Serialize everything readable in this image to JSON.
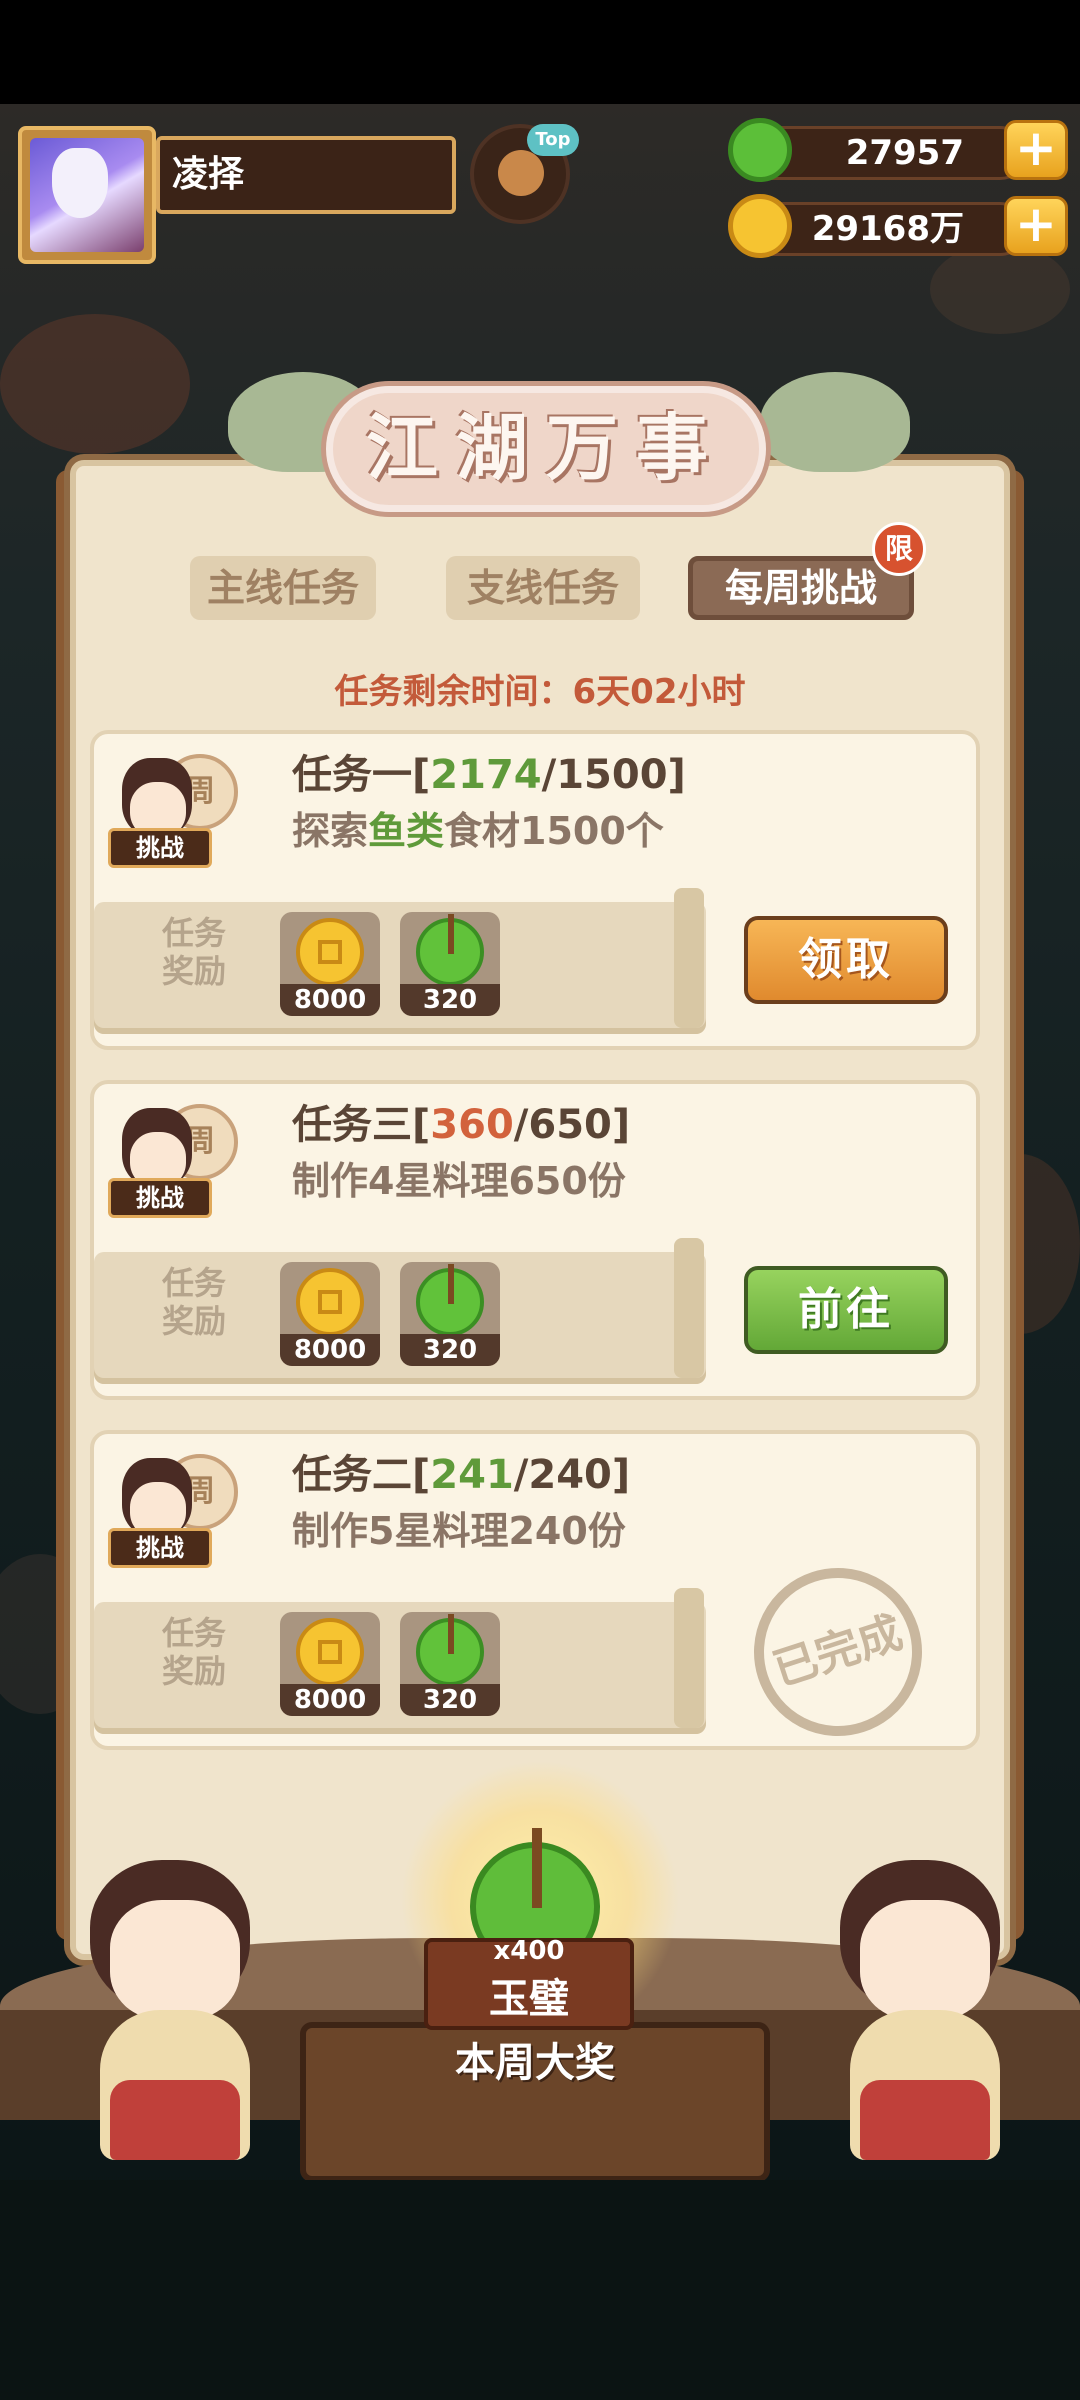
{
  "player": {
    "name": "凌择"
  },
  "top_icon": {
    "tag": "Top"
  },
  "currencies": {
    "jade": {
      "value": "27957",
      "icon": "jade-coin-icon"
    },
    "gold": {
      "value": "29168万",
      "icon": "gold-coin-icon"
    },
    "plus_label": "+"
  },
  "panel": {
    "title": "江湖万事",
    "tabs": [
      {
        "label": "主线任务",
        "active": false
      },
      {
        "label": "支线任务",
        "active": false
      },
      {
        "label": "每周挑战",
        "active": true,
        "badge": "限"
      }
    ],
    "timer": "任务剩余时间：6天02小时"
  },
  "tasks": [
    {
      "char_badge": "周",
      "char_label": "挑战",
      "title_prefix": "任务一[",
      "progress": "2174",
      "progress_color": "green",
      "sep": "/",
      "target": "1500",
      "title_suffix": "]",
      "desc_prefix": "探索",
      "desc_highlight": "鱼类",
      "desc_suffix": "食材1500个",
      "reward_label_1": "任务",
      "reward_label_2": "奖励",
      "rewards": [
        {
          "icon": "gold-coin-icon",
          "qty": "8000"
        },
        {
          "icon": "jade-coin-icon",
          "qty": "320"
        }
      ],
      "action": {
        "type": "claim",
        "label": "领取"
      }
    },
    {
      "char_badge": "周",
      "char_label": "挑战",
      "title_prefix": "任务三[",
      "progress": "360",
      "progress_color": "orange",
      "sep": "/",
      "target": "650",
      "title_suffix": "]",
      "desc_prefix": "制作4星料理650份",
      "desc_highlight": "",
      "desc_suffix": "",
      "reward_label_1": "任务",
      "reward_label_2": "奖励",
      "rewards": [
        {
          "icon": "gold-coin-icon",
          "qty": "8000"
        },
        {
          "icon": "jade-coin-icon",
          "qty": "320"
        }
      ],
      "action": {
        "type": "go",
        "label": "前往"
      }
    },
    {
      "char_badge": "周",
      "char_label": "挑战",
      "title_prefix": "任务二[",
      "progress": "241",
      "progress_color": "green",
      "sep": "/",
      "target": "240",
      "title_suffix": "]",
      "desc_prefix": "制作5星料理240份",
      "desc_highlight": "",
      "desc_suffix": "",
      "reward_label_1": "任务",
      "reward_label_2": "奖励",
      "rewards": [
        {
          "icon": "gold-coin-icon",
          "qty": "8000"
        },
        {
          "icon": "jade-coin-icon",
          "qty": "320"
        }
      ],
      "action": {
        "type": "done",
        "label": "已完成"
      }
    }
  ],
  "weekly_prize": {
    "qty": "x400",
    "name": "玉璧",
    "caption": "本周大奖"
  },
  "colors": {
    "accent_red": "#c35a3a",
    "progress_green": "#5f9a3a",
    "progress_orange": "#d2623c",
    "claim_button": "#e08a2e",
    "go_button": "#63a837"
  }
}
